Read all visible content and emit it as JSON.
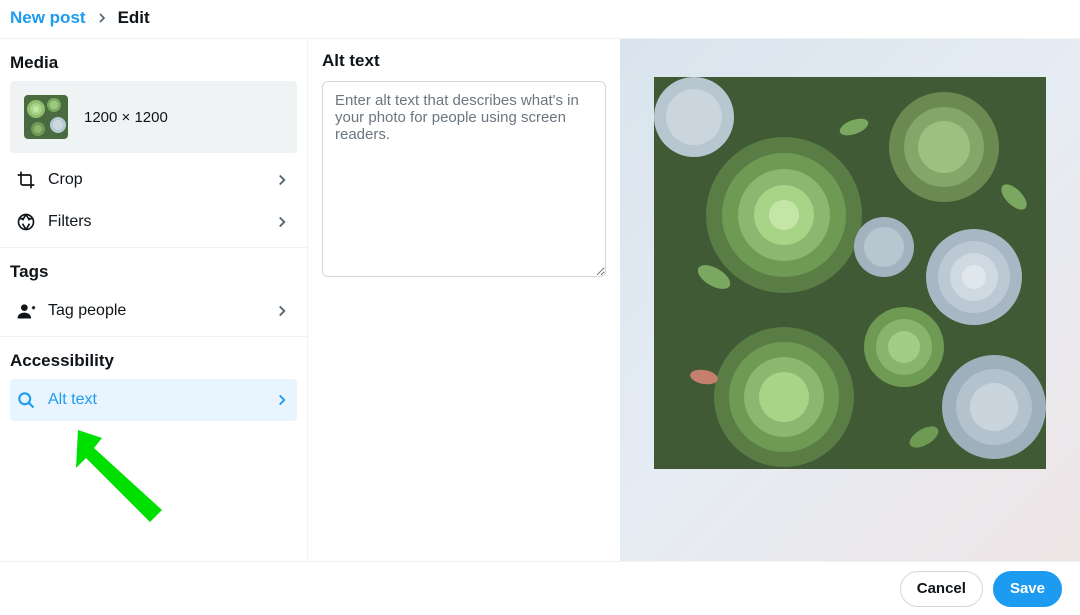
{
  "breadcrumb": {
    "parent": "New post",
    "current": "Edit"
  },
  "sidebar": {
    "media_title": "Media",
    "thumb_dims": "1200 × 1200",
    "crop_label": "Crop",
    "filters_label": "Filters",
    "tags_title": "Tags",
    "tag_people_label": "Tag people",
    "accessibility_title": "Accessibility",
    "alt_text_label": "Alt text"
  },
  "center": {
    "title": "Alt text",
    "placeholder": "Enter alt text that describes what's in your photo for people using screen readers.",
    "value": ""
  },
  "footer": {
    "cancel_label": "Cancel",
    "save_label": "Save"
  },
  "colors": {
    "accent": "#1d9bf0",
    "selected_bg": "#e8f5fe",
    "annotation": "#00e000"
  }
}
